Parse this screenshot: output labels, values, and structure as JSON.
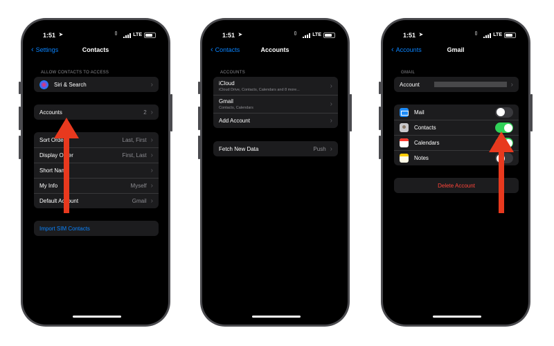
{
  "status": {
    "time": "1:51",
    "network": "LTE"
  },
  "screen1": {
    "back_label": "Settings",
    "title": "Contacts",
    "section_header": "ALLOW CONTACTS TO ACCESS",
    "siri_label": "Siri & Search",
    "accounts_label": "Accounts",
    "accounts_value": "2",
    "settings_rows": [
      {
        "label": "Sort Order",
        "value": "Last, First"
      },
      {
        "label": "Display Order",
        "value": "First, Last"
      },
      {
        "label": "Short Name",
        "value": ""
      },
      {
        "label": "My Info",
        "value": "Myself"
      },
      {
        "label": "Default Account",
        "value": "Gmail"
      }
    ],
    "import_label": "Import SIM Contacts"
  },
  "screen2": {
    "back_label": "Contacts",
    "title": "Accounts",
    "section_header": "ACCOUNTS",
    "icloud_label": "iCloud",
    "icloud_sub": "iCloud Drive, Contacts, Calendars and 8 more...",
    "gmail_label": "Gmail",
    "gmail_sub": "Contacts, Calendars",
    "add_account_label": "Add Account",
    "fetch_label": "Fetch New Data",
    "fetch_value": "Push"
  },
  "screen3": {
    "back_label": "Accounts",
    "title": "Gmail",
    "section_header": "GMAIL",
    "account_label": "Account",
    "services": [
      {
        "label": "Mail",
        "icon": "mail-icon",
        "enabled": false
      },
      {
        "label": "Contacts",
        "icon": "contacts-app-icon",
        "enabled": true
      },
      {
        "label": "Calendars",
        "icon": "calendar-icon",
        "enabled": true
      },
      {
        "label": "Notes",
        "icon": "notes-icon",
        "enabled": false
      }
    ],
    "delete_label": "Delete Account"
  },
  "colors": {
    "accent": "#0a84ff",
    "toggle_on": "#30d158",
    "arrow": "#e8391e",
    "danger": "#ff453a"
  }
}
